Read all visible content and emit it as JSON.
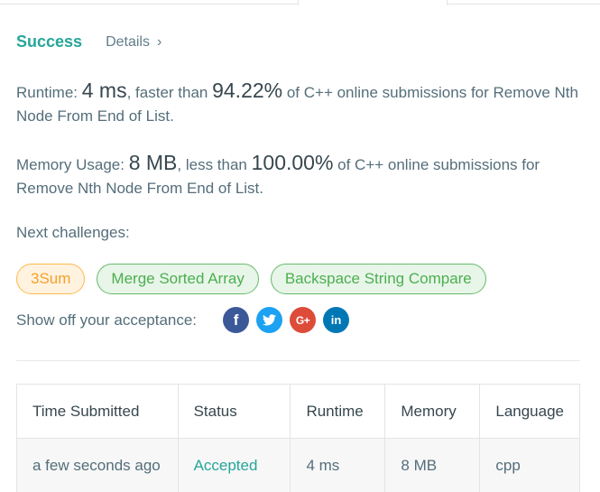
{
  "result": {
    "status": "Success",
    "details_label": "Details",
    "details_chevron": "›"
  },
  "runtime": {
    "label": "Runtime: ",
    "value": "4 ms",
    "mid": ", faster than ",
    "percent": "94.22%",
    "tail": " of C++ online submissions for Remove Nth Node From End of List."
  },
  "memory": {
    "label": "Memory Usage: ",
    "value": "8 MB",
    "mid": ", less than ",
    "percent": "100.00%",
    "tail": " of C++ online submissions for Remove Nth Node From End of List."
  },
  "next": {
    "label": "Next challenges:",
    "challenges": [
      "3Sum",
      "Merge Sorted Array",
      "Backspace String Compare"
    ]
  },
  "share": {
    "label": "Show off your acceptance:",
    "icons": [
      {
        "name": "facebook-icon",
        "glyph": "f"
      },
      {
        "name": "twitter-icon",
        "glyph": "t"
      },
      {
        "name": "google-plus-icon",
        "glyph": "G+"
      },
      {
        "name": "linkedin-icon",
        "glyph": "in"
      }
    ]
  },
  "table": {
    "headers": [
      "Time Submitted",
      "Status",
      "Runtime",
      "Memory",
      "Language"
    ],
    "rows": [
      [
        "a few seconds ago",
        "Accepted",
        "4 ms",
        "8 MB",
        "cpp"
      ]
    ]
  },
  "colors": {
    "success": "#26a69a",
    "easy_orange": "#f6a12a",
    "easy_green": "#4caf50",
    "facebook": "#3b5998",
    "twitter": "#1da1f2",
    "google_plus": "#dd4b39",
    "linkedin": "#0077b5"
  }
}
